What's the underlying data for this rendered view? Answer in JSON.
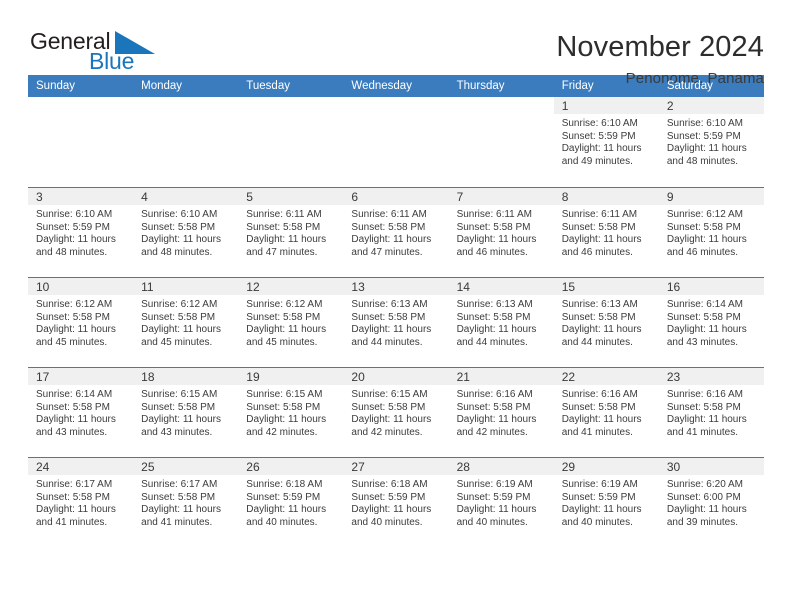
{
  "logo": {
    "word_one": "General",
    "word_two": "Blue",
    "triangle_color": "#1b75bb",
    "text_color": "#231f20"
  },
  "header": {
    "title": "November 2024",
    "subtitle": "Penonome, Panama"
  },
  "theme": {
    "header_blue": "#3b7cbe",
    "band_gray": "#f0f0f0",
    "text": "#3c3c3c"
  },
  "weekdays": [
    "Sunday",
    "Monday",
    "Tuesday",
    "Wednesday",
    "Thursday",
    "Friday",
    "Saturday"
  ],
  "weeks": [
    [
      {
        "day": "",
        "sunrise": "",
        "sunset": "",
        "daylight": "",
        "daylight2": ""
      },
      {
        "day": "",
        "sunrise": "",
        "sunset": "",
        "daylight": "",
        "daylight2": ""
      },
      {
        "day": "",
        "sunrise": "",
        "sunset": "",
        "daylight": "",
        "daylight2": ""
      },
      {
        "day": "",
        "sunrise": "",
        "sunset": "",
        "daylight": "",
        "daylight2": ""
      },
      {
        "day": "",
        "sunrise": "",
        "sunset": "",
        "daylight": "",
        "daylight2": ""
      },
      {
        "day": "1",
        "sunrise": "Sunrise: 6:10 AM",
        "sunset": "Sunset: 5:59 PM",
        "daylight": "Daylight: 11 hours",
        "daylight2": "and 49 minutes."
      },
      {
        "day": "2",
        "sunrise": "Sunrise: 6:10 AM",
        "sunset": "Sunset: 5:59 PM",
        "daylight": "Daylight: 11 hours",
        "daylight2": "and 48 minutes."
      }
    ],
    [
      {
        "day": "3",
        "sunrise": "Sunrise: 6:10 AM",
        "sunset": "Sunset: 5:59 PM",
        "daylight": "Daylight: 11 hours",
        "daylight2": "and 48 minutes."
      },
      {
        "day": "4",
        "sunrise": "Sunrise: 6:10 AM",
        "sunset": "Sunset: 5:58 PM",
        "daylight": "Daylight: 11 hours",
        "daylight2": "and 48 minutes."
      },
      {
        "day": "5",
        "sunrise": "Sunrise: 6:11 AM",
        "sunset": "Sunset: 5:58 PM",
        "daylight": "Daylight: 11 hours",
        "daylight2": "and 47 minutes."
      },
      {
        "day": "6",
        "sunrise": "Sunrise: 6:11 AM",
        "sunset": "Sunset: 5:58 PM",
        "daylight": "Daylight: 11 hours",
        "daylight2": "and 47 minutes."
      },
      {
        "day": "7",
        "sunrise": "Sunrise: 6:11 AM",
        "sunset": "Sunset: 5:58 PM",
        "daylight": "Daylight: 11 hours",
        "daylight2": "and 46 minutes."
      },
      {
        "day": "8",
        "sunrise": "Sunrise: 6:11 AM",
        "sunset": "Sunset: 5:58 PM",
        "daylight": "Daylight: 11 hours",
        "daylight2": "and 46 minutes."
      },
      {
        "day": "9",
        "sunrise": "Sunrise: 6:12 AM",
        "sunset": "Sunset: 5:58 PM",
        "daylight": "Daylight: 11 hours",
        "daylight2": "and 46 minutes."
      }
    ],
    [
      {
        "day": "10",
        "sunrise": "Sunrise: 6:12 AM",
        "sunset": "Sunset: 5:58 PM",
        "daylight": "Daylight: 11 hours",
        "daylight2": "and 45 minutes."
      },
      {
        "day": "11",
        "sunrise": "Sunrise: 6:12 AM",
        "sunset": "Sunset: 5:58 PM",
        "daylight": "Daylight: 11 hours",
        "daylight2": "and 45 minutes."
      },
      {
        "day": "12",
        "sunrise": "Sunrise: 6:12 AM",
        "sunset": "Sunset: 5:58 PM",
        "daylight": "Daylight: 11 hours",
        "daylight2": "and 45 minutes."
      },
      {
        "day": "13",
        "sunrise": "Sunrise: 6:13 AM",
        "sunset": "Sunset: 5:58 PM",
        "daylight": "Daylight: 11 hours",
        "daylight2": "and 44 minutes."
      },
      {
        "day": "14",
        "sunrise": "Sunrise: 6:13 AM",
        "sunset": "Sunset: 5:58 PM",
        "daylight": "Daylight: 11 hours",
        "daylight2": "and 44 minutes."
      },
      {
        "day": "15",
        "sunrise": "Sunrise: 6:13 AM",
        "sunset": "Sunset: 5:58 PM",
        "daylight": "Daylight: 11 hours",
        "daylight2": "and 44 minutes."
      },
      {
        "day": "16",
        "sunrise": "Sunrise: 6:14 AM",
        "sunset": "Sunset: 5:58 PM",
        "daylight": "Daylight: 11 hours",
        "daylight2": "and 43 minutes."
      }
    ],
    [
      {
        "day": "17",
        "sunrise": "Sunrise: 6:14 AM",
        "sunset": "Sunset: 5:58 PM",
        "daylight": "Daylight: 11 hours",
        "daylight2": "and 43 minutes."
      },
      {
        "day": "18",
        "sunrise": "Sunrise: 6:15 AM",
        "sunset": "Sunset: 5:58 PM",
        "daylight": "Daylight: 11 hours",
        "daylight2": "and 43 minutes."
      },
      {
        "day": "19",
        "sunrise": "Sunrise: 6:15 AM",
        "sunset": "Sunset: 5:58 PM",
        "daylight": "Daylight: 11 hours",
        "daylight2": "and 42 minutes."
      },
      {
        "day": "20",
        "sunrise": "Sunrise: 6:15 AM",
        "sunset": "Sunset: 5:58 PM",
        "daylight": "Daylight: 11 hours",
        "daylight2": "and 42 minutes."
      },
      {
        "day": "21",
        "sunrise": "Sunrise: 6:16 AM",
        "sunset": "Sunset: 5:58 PM",
        "daylight": "Daylight: 11 hours",
        "daylight2": "and 42 minutes."
      },
      {
        "day": "22",
        "sunrise": "Sunrise: 6:16 AM",
        "sunset": "Sunset: 5:58 PM",
        "daylight": "Daylight: 11 hours",
        "daylight2": "and 41 minutes."
      },
      {
        "day": "23",
        "sunrise": "Sunrise: 6:16 AM",
        "sunset": "Sunset: 5:58 PM",
        "daylight": "Daylight: 11 hours",
        "daylight2": "and 41 minutes."
      }
    ],
    [
      {
        "day": "24",
        "sunrise": "Sunrise: 6:17 AM",
        "sunset": "Sunset: 5:58 PM",
        "daylight": "Daylight: 11 hours",
        "daylight2": "and 41 minutes."
      },
      {
        "day": "25",
        "sunrise": "Sunrise: 6:17 AM",
        "sunset": "Sunset: 5:58 PM",
        "daylight": "Daylight: 11 hours",
        "daylight2": "and 41 minutes."
      },
      {
        "day": "26",
        "sunrise": "Sunrise: 6:18 AM",
        "sunset": "Sunset: 5:59 PM",
        "daylight": "Daylight: 11 hours",
        "daylight2": "and 40 minutes."
      },
      {
        "day": "27",
        "sunrise": "Sunrise: 6:18 AM",
        "sunset": "Sunset: 5:59 PM",
        "daylight": "Daylight: 11 hours",
        "daylight2": "and 40 minutes."
      },
      {
        "day": "28",
        "sunrise": "Sunrise: 6:19 AM",
        "sunset": "Sunset: 5:59 PM",
        "daylight": "Daylight: 11 hours",
        "daylight2": "and 40 minutes."
      },
      {
        "day": "29",
        "sunrise": "Sunrise: 6:19 AM",
        "sunset": "Sunset: 5:59 PM",
        "daylight": "Daylight: 11 hours",
        "daylight2": "and 40 minutes."
      },
      {
        "day": "30",
        "sunrise": "Sunrise: 6:20 AM",
        "sunset": "Sunset: 6:00 PM",
        "daylight": "Daylight: 11 hours",
        "daylight2": "and 39 minutes."
      }
    ]
  ]
}
